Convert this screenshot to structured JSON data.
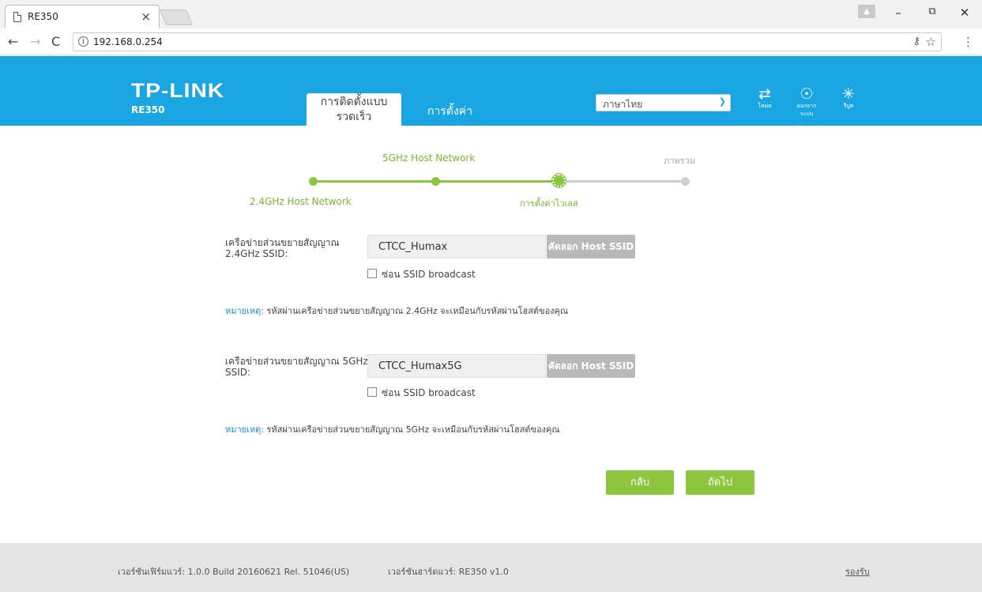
{
  "browser": {
    "tab_title": "RE350",
    "tab_close": "×",
    "url": "192.168.0.254",
    "info": "i",
    "icons": [
      "page-icon",
      "back-icon",
      "forward-icon",
      "reload-icon",
      "info-icon",
      "key-icon",
      "star-icon",
      "menu-icon",
      "user-icon",
      "minimize-icon",
      "restore-icon",
      "close-window-icon"
    ]
  },
  "header": {
    "logo": "TP-LINK",
    "model": "RE350",
    "tab_quick_setup_line1": "การติดตั้งแบบ",
    "tab_quick_setup_line2": "รวดเร็ว",
    "tab_settings": "การตั้งค่า",
    "language_value": "ภาษาไทย",
    "icon_mode": "โหมด",
    "icon_logout_line1": "ออกจาก",
    "icon_logout_line2": "ระบบ",
    "icon_reboot": "รีบูต"
  },
  "steps": {
    "step1": "2.4GHz Host Network",
    "step2": "5GHz Host Network",
    "step3": "การตั้งค่าไวเลส",
    "step4": "ภาพรวม",
    "current_step": 3,
    "total_steps": 4
  },
  "form": {
    "ssid24": {
      "label_line1": "เครือข่ายส่วนขยายสัญญาณ",
      "label_line2": "2.4GHz SSID:",
      "value": "CTCC_Humax",
      "copy_button": "คัดลอก Host SSID",
      "hide_label": "ซ่อน SSID broadcast",
      "hide_checked": false
    },
    "note24_key": "หมายเหตุ:",
    "note24_text": "รหัสผ่านเครือข่ายส่วนขยายสัญญาณ 2.4GHz จะเหมือนกับรหัสผ่านโฮสต์ของคุณ",
    "ssid5": {
      "label_line1": "เครือข่ายส่วนขยายสัญญาณ 5GHz",
      "label_line2": "SSID:",
      "value": "CTCC_Humax5G",
      "copy_button": "คัดลอก Host SSID",
      "hide_label": "ซ่อน SSID broadcast",
      "hide_checked": false
    },
    "note5_key": "หมายเหตุ:",
    "note5_text": "รหัสผ่านเครือข่ายส่วนขยายสัญญาณ 5GHz จะเหมือนกับรหัสผ่านโฮสต์ของคุณ"
  },
  "actions": {
    "back": "กลับ",
    "next": "ถัดไป"
  },
  "footer": {
    "firmware": "เวอร์ชันเฟิร์มแวร์: 1.0.0 Build 20160621 Rel. 51046(US)",
    "hardware": "เวอร์ชันฮาร์ดแวร์: RE350 v1.0",
    "support": "รองรับ"
  },
  "colors": {
    "brand_blue": "#1aa6e2",
    "accent_green": "#8dc63f",
    "disabled_gray": "#b9b9b9"
  }
}
